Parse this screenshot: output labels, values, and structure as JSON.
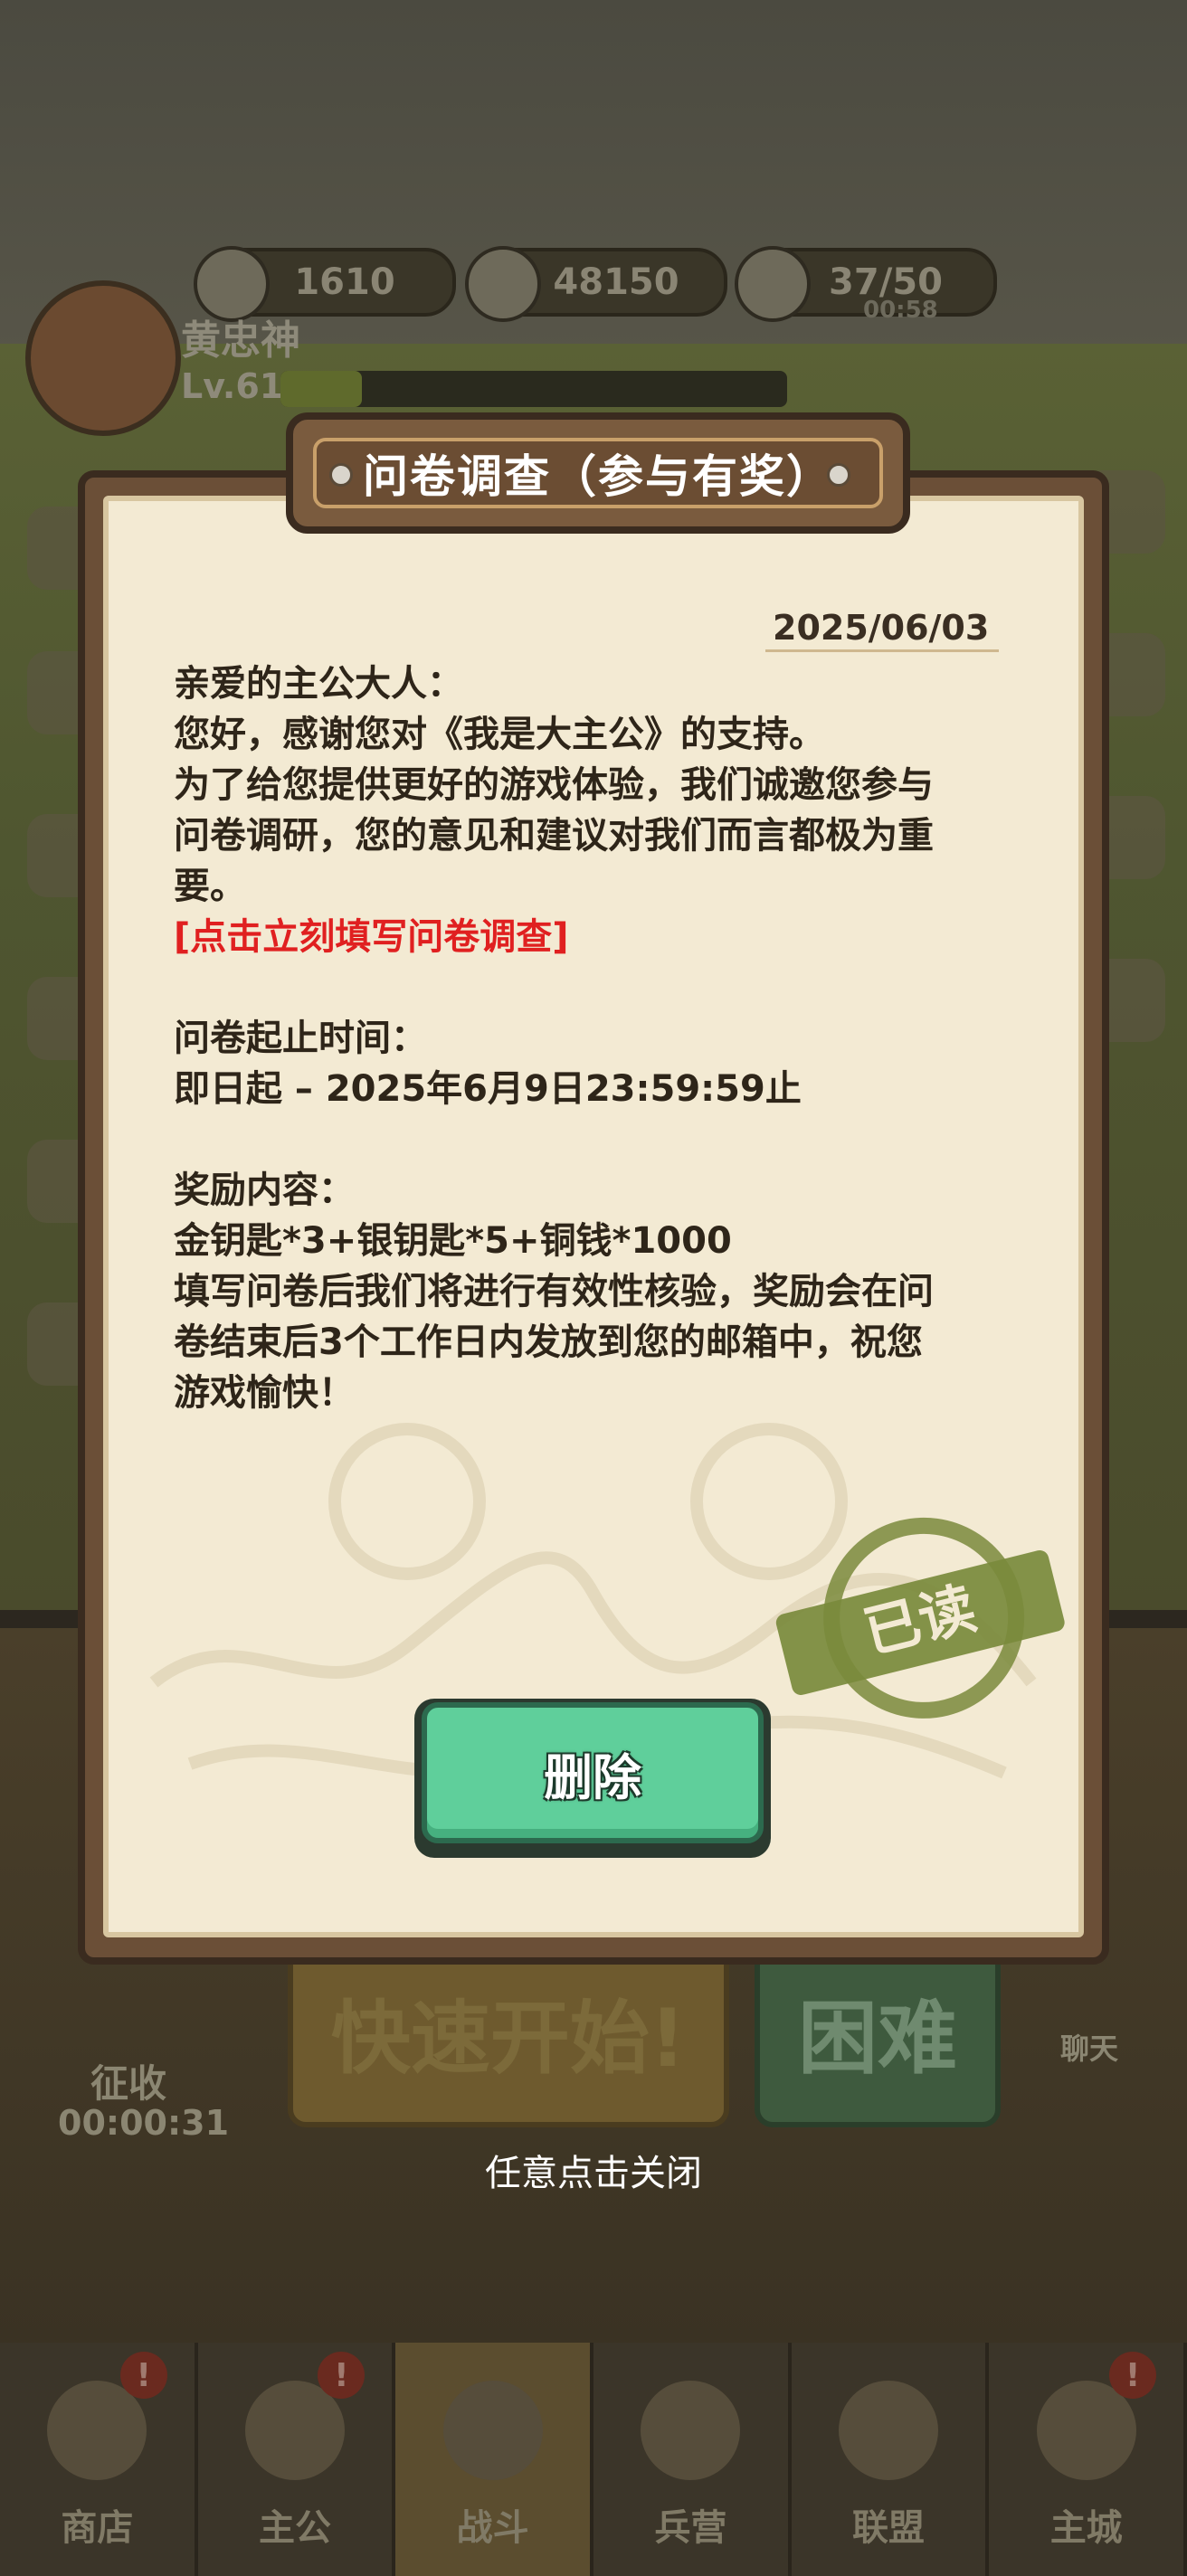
{
  "background": {
    "resources": [
      {
        "icon": "gold-ingot-icon",
        "value": "1610"
      },
      {
        "icon": "coin-icon",
        "value": "48150"
      },
      {
        "icon": "stamina-icon",
        "value": "37/50",
        "timer": "00:58"
      }
    ],
    "player": {
      "name": "黄忠神",
      "level": "Lv.61",
      "level_progress": 0.16
    },
    "big_buttons": {
      "quick_start": "快速开始!",
      "hard": "困难"
    },
    "collect": {
      "label": "征收",
      "timer": "00:00:31"
    },
    "chat_label": "聊天"
  },
  "mail": {
    "title": "问卷调查（参与有奖）",
    "date": "2025/06/03",
    "greeting": "亲爱的主公大人：",
    "line1": "您好，感谢您对《我是大主公》的支持。",
    "line2a": "为了给您提供更好的游戏体验，我们诚邀您参与",
    "line2b": "问卷调研，您的意见和建议对我们而言都极为重",
    "line2c": "要。",
    "survey_link": "[点击立刻填写问卷调查]",
    "period_label": "问卷起止时间：",
    "period_value": "即日起 – 2025年6月9日23:59:59止",
    "reward_label": "奖励内容：",
    "reward_value": "金钥匙*3+银钥匙*5+铜钱*1000",
    "note_a": "填写问卷后我们将进行有效性核验，奖励会在问",
    "note_b": "卷结束后3个工作日内发放到您的邮箱中，祝您",
    "note_c": "游戏愉快！",
    "stamp_text": "已读",
    "delete_label": "删除"
  },
  "close_hint": "任意点击关闭",
  "bottom_nav": [
    {
      "label": "商店",
      "alert": "!"
    },
    {
      "label": "主公",
      "alert": "!"
    },
    {
      "label": "战斗",
      "alert": ""
    },
    {
      "label": "兵营",
      "alert": ""
    },
    {
      "label": "联盟",
      "alert": ""
    },
    {
      "label": "主城",
      "alert": "!"
    }
  ],
  "colors": {
    "paper": "#f3ead3",
    "frame": "#6b4f37",
    "link_red": "#e02020",
    "delete_green": "#5fcf9b",
    "stamp_green": "#7a8a3c"
  }
}
